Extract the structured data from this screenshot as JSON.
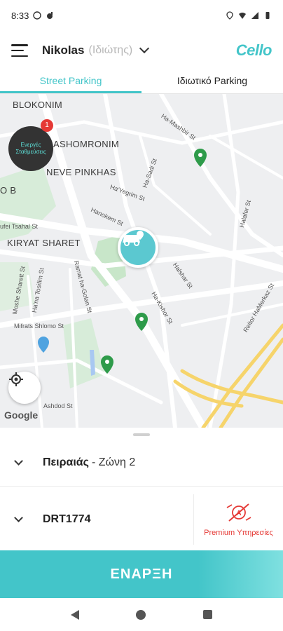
{
  "status": {
    "time": "8:33"
  },
  "header": {
    "user_name": "Nikolas",
    "user_type": "(Ιδιώτης)",
    "logo": "Cello"
  },
  "tabs": [
    {
      "label": "Street Parking",
      "active": true
    },
    {
      "label": "Ιδιωτικό Parking",
      "active": false
    }
  ],
  "map": {
    "labels": {
      "blokonim": "BLOKONIM",
      "shomronim": "ASHOMRONIM",
      "neve": "NEVE PINKHAS",
      "kiryat": "KIRYAT SHARET",
      "ob": "O B",
      "tsahal": "ufei Tsahal St",
      "mifrats": "Mifrats Shlomo St",
      "ashdod": "Ashdod St",
      "hamashbir": "Ha-Mashbir St",
      "hasadi": "Ha-Sadi St",
      "hakim": "Ha-Kim St",
      "hayegrim": "Ha'Yegrim St",
      "hanokem": "Hanokem St",
      "halafer": "Halafer St",
      "ramat": "Ramat ha-Golan St",
      "moshe": "Moshe Sharett St",
      "harna": "Ha'na Tosifim St",
      "halshar": "Halshar St",
      "hakishor": "Ha-Kishor St",
      "reitor": "Reitor HaMerkaz St"
    },
    "active_badge": {
      "label": "Ενεργές Σταθμεύσεις",
      "count": "1"
    },
    "google_logo": "Google"
  },
  "zone": {
    "city": "Πειραιάς",
    "rest": "- Ζώνη 2"
  },
  "vehicle": {
    "plate": "DRT1774"
  },
  "premium": {
    "label": "Premium Υπηρεσίες"
  },
  "start_button": {
    "label": "ΕΝΑΡΞΗ"
  },
  "colors": {
    "accent": "#43c5c9",
    "alert": "#e53935",
    "pin_green": "#2e9b4a"
  }
}
